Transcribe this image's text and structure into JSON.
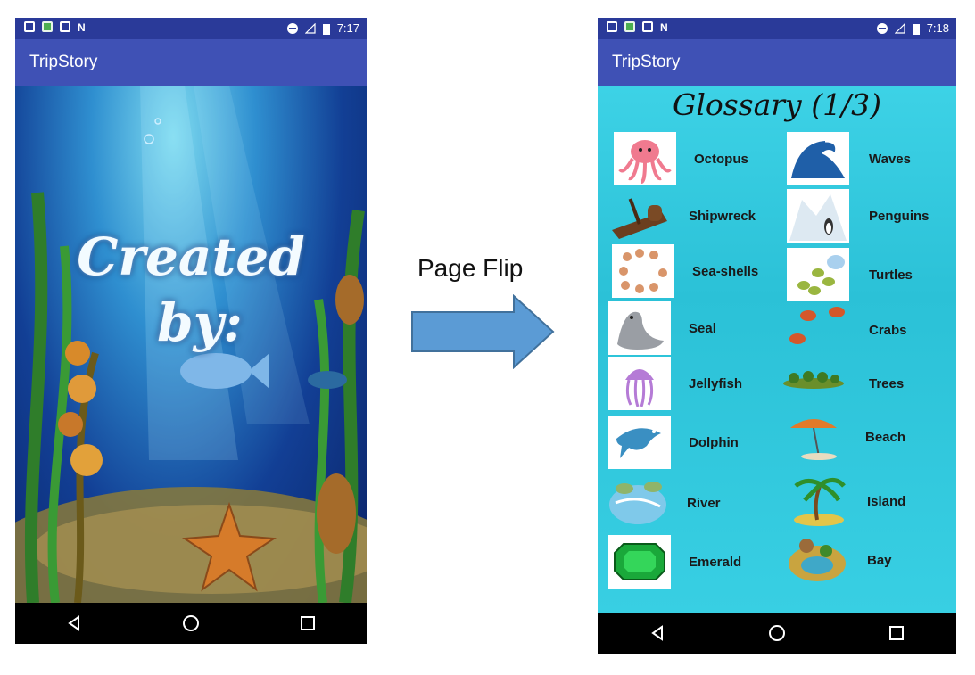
{
  "left_phone": {
    "status_time": "7:17",
    "app_title": "TripStory",
    "cover_line1": "Created",
    "cover_line2": "by:"
  },
  "transition": {
    "label": "Page Flip",
    "arrow_color": "#5b9bd5"
  },
  "right_phone": {
    "status_time": "7:18",
    "app_title": "TripStory",
    "glossary_title": "Glossary (1/3)",
    "left_column": [
      {
        "label": "Octopus",
        "icon": "octopus-icon"
      },
      {
        "label": "Shipwreck",
        "icon": "shipwreck-icon"
      },
      {
        "label": "Sea-shells",
        "icon": "seashells-icon"
      },
      {
        "label": "Seal",
        "icon": "seal-icon"
      },
      {
        "label": "Jellyfish",
        "icon": "jellyfish-icon"
      },
      {
        "label": "Dolphin",
        "icon": "dolphin-icon"
      },
      {
        "label": "River",
        "icon": "river-icon"
      },
      {
        "label": "Emerald",
        "icon": "emerald-icon"
      }
    ],
    "right_column": [
      {
        "label": "Waves",
        "icon": "waves-icon"
      },
      {
        "label": "Penguins",
        "icon": "penguins-icon"
      },
      {
        "label": "Turtles",
        "icon": "turtles-icon"
      },
      {
        "label": "Crabs",
        "icon": "crabs-icon"
      },
      {
        "label": "Trees",
        "icon": "trees-icon"
      },
      {
        "label": "Beach",
        "icon": "beach-icon"
      },
      {
        "label": "Island",
        "icon": "island-icon"
      },
      {
        "label": "Bay",
        "icon": "bay-icon"
      }
    ]
  },
  "colors": {
    "status_bar": "#2a3a99",
    "app_bar": "#3f51b5",
    "glossary_bg": "#2bc1d7"
  }
}
